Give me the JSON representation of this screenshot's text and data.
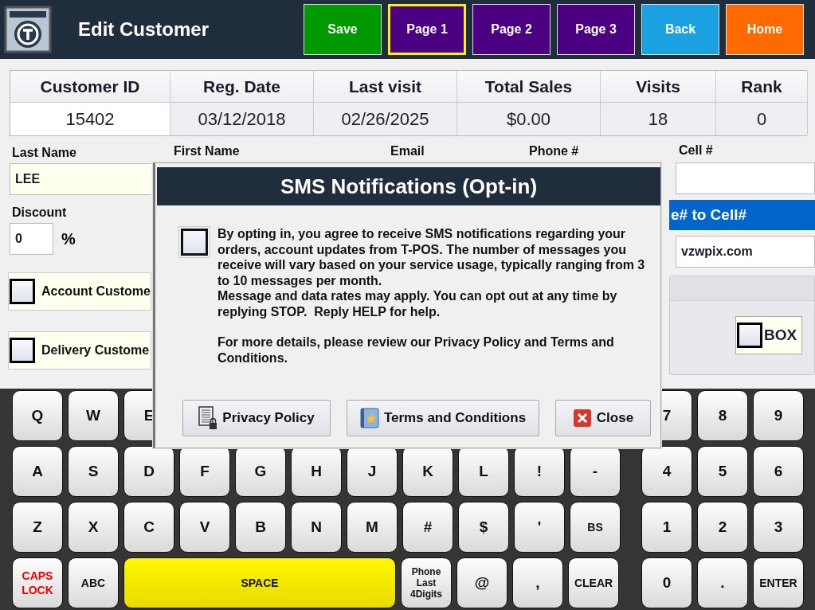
{
  "header": {
    "title": "Edit Customer",
    "buttons": [
      {
        "label": "Save",
        "color": "#009a00",
        "selected": false
      },
      {
        "label": "Page 1",
        "color": "#4b0082",
        "selected": true
      },
      {
        "label": "Page 2",
        "color": "#4b0082",
        "selected": false
      },
      {
        "label": "Page 3",
        "color": "#4b0082",
        "selected": false
      },
      {
        "label": "Back",
        "color": "#1ba1e2",
        "selected": false
      },
      {
        "label": "Home",
        "color": "#ff6a00",
        "selected": false
      }
    ]
  },
  "summary": {
    "columns": [
      "Customer ID",
      "Reg. Date",
      "Last visit",
      "Total Sales",
      "Visits",
      "Rank"
    ],
    "row": [
      "15402",
      "03/12/2018",
      "02/26/2025",
      "$0.00",
      "18",
      "0"
    ]
  },
  "form": {
    "last_name": {
      "label": "Last Name",
      "value": "LEE"
    },
    "discount": {
      "label": "Discount",
      "value": "0",
      "unit": "%"
    },
    "checks": [
      {
        "label": "Account Custome",
        "checked": false
      },
      {
        "label": "Delivery Custome",
        "checked": false
      }
    ],
    "labels": [
      "First Name",
      "Email",
      "Phone #"
    ],
    "cell": {
      "label": "Cell #"
    },
    "copy_button": "e# to Cell#",
    "carrier": {
      "value": "vzwpix.com"
    },
    "box": {
      "label": "BOX",
      "checked": false
    }
  },
  "dialog": {
    "title": "SMS Notifications (Opt-in)",
    "checked": false,
    "paragraphs": [
      "By opting in, you agree to receive SMS notifications regarding your orders, account updates from T-POS. The number of messages you receive will vary based on your service usage, typically ranging from 3 to 10 messages per month.\nMessage and data rates may apply. You can opt out at any time by replying STOP.  Reply HELP for help.",
      "For more details, please review our Privacy Policy and Terms and Conditions."
    ],
    "buttons": [
      {
        "label": "Privacy Policy",
        "kind": "privacy"
      },
      {
        "label": "Terms and Conditions",
        "kind": "terms"
      },
      {
        "label": "Close",
        "kind": "close"
      }
    ]
  },
  "keyboard": {
    "rows": [
      {
        "keys": [
          {
            "label": "Q",
            "kind": "key"
          },
          {
            "label": "W",
            "kind": "key"
          },
          {
            "label": "E",
            "kind": "key"
          }
        ],
        "numpad": [
          {
            "label": "7",
            "kind": "key"
          },
          {
            "label": "8",
            "kind": "key"
          },
          {
            "label": "9",
            "kind": "key"
          }
        ]
      },
      {
        "keys": [
          {
            "label": "A",
            "kind": "key"
          },
          {
            "label": "S",
            "kind": "key"
          },
          {
            "label": "D",
            "kind": "key"
          },
          {
            "label": "F",
            "kind": "key"
          },
          {
            "label": "G",
            "kind": "key"
          },
          {
            "label": "H",
            "kind": "key"
          },
          {
            "label": "J",
            "kind": "key"
          },
          {
            "label": "K",
            "kind": "key"
          },
          {
            "label": "L",
            "kind": "key"
          },
          {
            "label": "!",
            "kind": "key"
          },
          {
            "label": "-",
            "kind": "key"
          }
        ],
        "numpad": [
          {
            "label": "4",
            "kind": "key"
          },
          {
            "label": "5",
            "kind": "key"
          },
          {
            "label": "6",
            "kind": "key"
          }
        ]
      },
      {
        "keys": [
          {
            "label": "Z",
            "kind": "key"
          },
          {
            "label": "X",
            "kind": "key"
          },
          {
            "label": "C",
            "kind": "key"
          },
          {
            "label": "V",
            "kind": "key"
          },
          {
            "label": "B",
            "kind": "key"
          },
          {
            "label": "N",
            "kind": "key"
          },
          {
            "label": "M",
            "kind": "key"
          },
          {
            "label": "#",
            "kind": "key"
          },
          {
            "label": "$",
            "kind": "key"
          },
          {
            "label": "'",
            "kind": "key"
          },
          {
            "label": "BS",
            "kind": "small"
          }
        ],
        "numpad": [
          {
            "label": "1",
            "kind": "key"
          },
          {
            "label": "2",
            "kind": "key"
          },
          {
            "label": "3",
            "kind": "key"
          }
        ]
      },
      {
        "keys": [
          {
            "label": "CAPS\nLOCK",
            "kind": "caps"
          },
          {
            "label": "ABC",
            "kind": "small"
          },
          {
            "label": "SPACE",
            "kind": "space"
          },
          {
            "label": "Phone\nLast\n4Digits",
            "kind": "tiny"
          },
          {
            "label": "@",
            "kind": "key"
          },
          {
            "label": ",",
            "kind": "key"
          },
          {
            "label": "CLEAR",
            "kind": "small"
          }
        ],
        "numpad": [
          {
            "label": "0",
            "kind": "key"
          },
          {
            "label": ".",
            "kind": "key"
          },
          {
            "label": "ENTER",
            "kind": "small"
          }
        ]
      }
    ]
  }
}
